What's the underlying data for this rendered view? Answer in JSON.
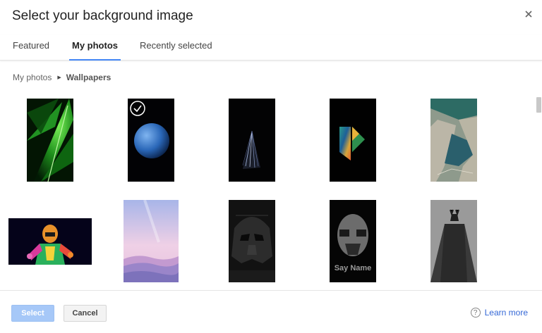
{
  "dialog": {
    "title": "Select your background image",
    "close_icon": "close-icon"
  },
  "tabs": [
    {
      "label": "Featured",
      "active": false
    },
    {
      "label": "My photos",
      "active": true
    },
    {
      "label": "Recently selected",
      "active": false
    }
  ],
  "breadcrumb": {
    "root": "My photos",
    "current": "Wallpapers"
  },
  "photos": [
    {
      "name": "green-leaf-wallpaper",
      "selected": false
    },
    {
      "name": "blue-planet-wallpaper",
      "selected": true
    },
    {
      "name": "dark-feather-wallpaper",
      "selected": false
    },
    {
      "name": "colorful-p-logo-wallpaper",
      "selected": false
    },
    {
      "name": "aerial-landscape-wallpaper",
      "selected": false
    },
    {
      "name": "neon-figure-wallpaper",
      "selected": false
    },
    {
      "name": "pastel-mountains-wallpaper",
      "selected": false
    },
    {
      "name": "darth-vader-wallpaper",
      "selected": false
    },
    {
      "name": "say-my-name-wallpaper",
      "selected": false
    },
    {
      "name": "batman-wallpaper",
      "selected": false
    }
  ],
  "footer": {
    "select_label": "Select",
    "cancel_label": "Cancel",
    "learn_more_label": "Learn more",
    "help_symbol": "?"
  },
  "colors": {
    "accent": "#4285f4",
    "select_button": "#a6c8f8",
    "link": "#3367d6"
  }
}
